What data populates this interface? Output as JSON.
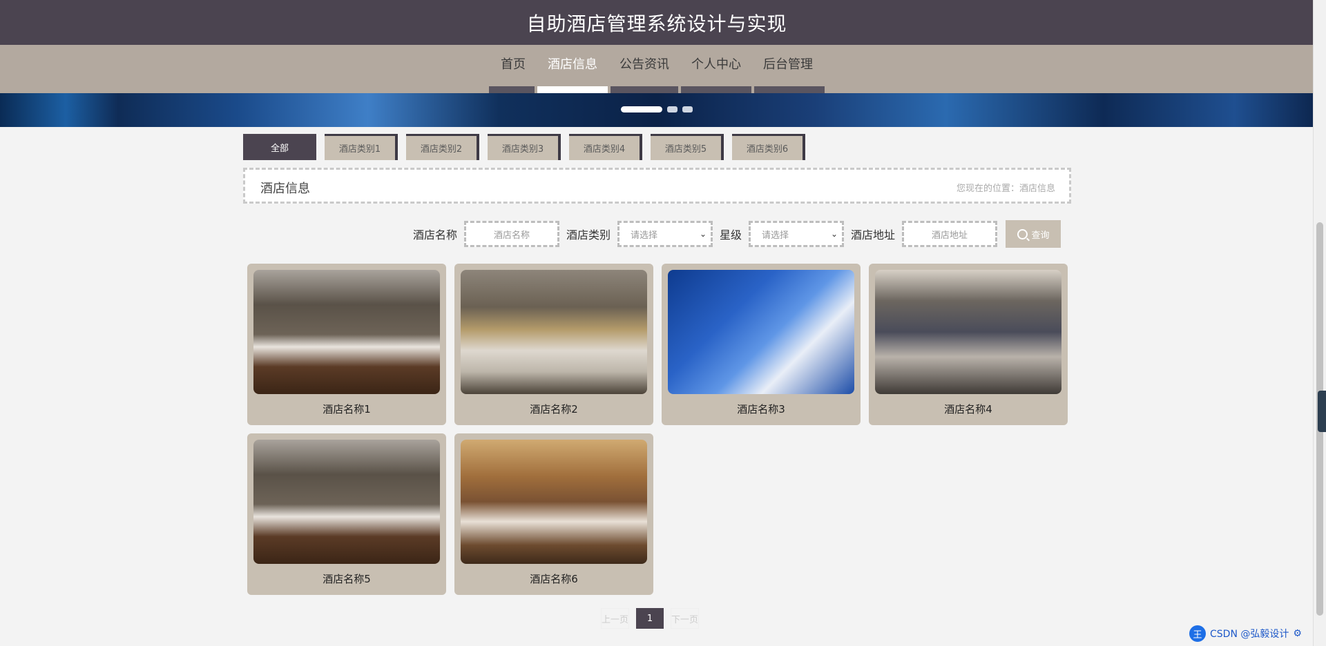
{
  "header": {
    "title": "自助酒店管理系统设计与实现"
  },
  "nav": {
    "items": [
      {
        "label": "首页",
        "active": false
      },
      {
        "label": "酒店信息",
        "active": true
      },
      {
        "label": "公告资讯",
        "active": false
      },
      {
        "label": "个人中心",
        "active": false
      },
      {
        "label": "后台管理",
        "active": false
      }
    ]
  },
  "banner": {
    "slides": 3,
    "active_slide": 1
  },
  "categories": [
    "全部",
    "酒店类别1",
    "酒店类别2",
    "酒店类别3",
    "酒店类别4",
    "酒店类别5",
    "酒店类别6"
  ],
  "section": {
    "title": "酒店信息",
    "breadcrumb": "您现在的位置：酒店信息"
  },
  "search": {
    "name_label": "酒店名称",
    "name_placeholder": "酒店名称",
    "type_label": "酒店类别",
    "type_value": "请选择",
    "star_label": "星级",
    "star_value": "请选择",
    "address_label": "酒店地址",
    "address_placeholder": "酒店地址",
    "button_label": "查询"
  },
  "hotels": [
    {
      "name": "酒店名称1"
    },
    {
      "name": "酒店名称2"
    },
    {
      "name": "酒店名称3"
    },
    {
      "name": "酒店名称4"
    },
    {
      "name": "酒店名称5"
    },
    {
      "name": "酒店名称6"
    }
  ],
  "pagination": {
    "prev": "上一页",
    "current": "1",
    "next": "下一页"
  },
  "watermark": {
    "text": "CSDN @弘毅设计",
    "icon": "王"
  },
  "colors": {
    "header": "#4b4450",
    "nav": "#b3a99f",
    "card": "#c8bfb2",
    "accent_text": "#ffffff"
  }
}
